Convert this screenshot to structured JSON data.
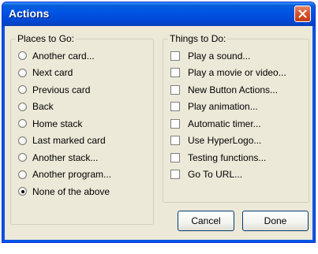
{
  "window": {
    "title": "Actions"
  },
  "places_group": {
    "title": "Places to Go:",
    "selected": "None of the above",
    "options": [
      {
        "label": "Another card...",
        "checked": false
      },
      {
        "label": "Next card",
        "checked": false
      },
      {
        "label": "Previous card",
        "checked": false
      },
      {
        "label": "Back",
        "checked": false
      },
      {
        "label": "Home stack",
        "checked": false
      },
      {
        "label": "Last marked card",
        "checked": false
      },
      {
        "label": "Another stack...",
        "checked": false
      },
      {
        "label": "Another program...",
        "checked": false
      },
      {
        "label": "None of the above",
        "checked": true
      }
    ]
  },
  "things_group": {
    "title": "Things to Do:",
    "options": [
      {
        "label": "Play a sound...",
        "checked": false
      },
      {
        "label": "Play a movie or video...",
        "checked": false
      },
      {
        "label": "New Button Actions...",
        "checked": false
      },
      {
        "label": "Play animation...",
        "checked": false
      },
      {
        "label": "Automatic timer...",
        "checked": false
      },
      {
        "label": "Use HyperLogo...",
        "checked": false
      },
      {
        "label": "Testing functions...",
        "checked": false
      },
      {
        "label": "Go To URL...",
        "checked": false
      }
    ]
  },
  "buttons": {
    "cancel": "Cancel",
    "done": "Done"
  },
  "icons": {
    "close": "close-icon"
  },
  "colors": {
    "titlebar": "#0055e5",
    "close_button": "#d9542b",
    "dialog_background": "#ece9d8",
    "button_border": "#003c74"
  }
}
